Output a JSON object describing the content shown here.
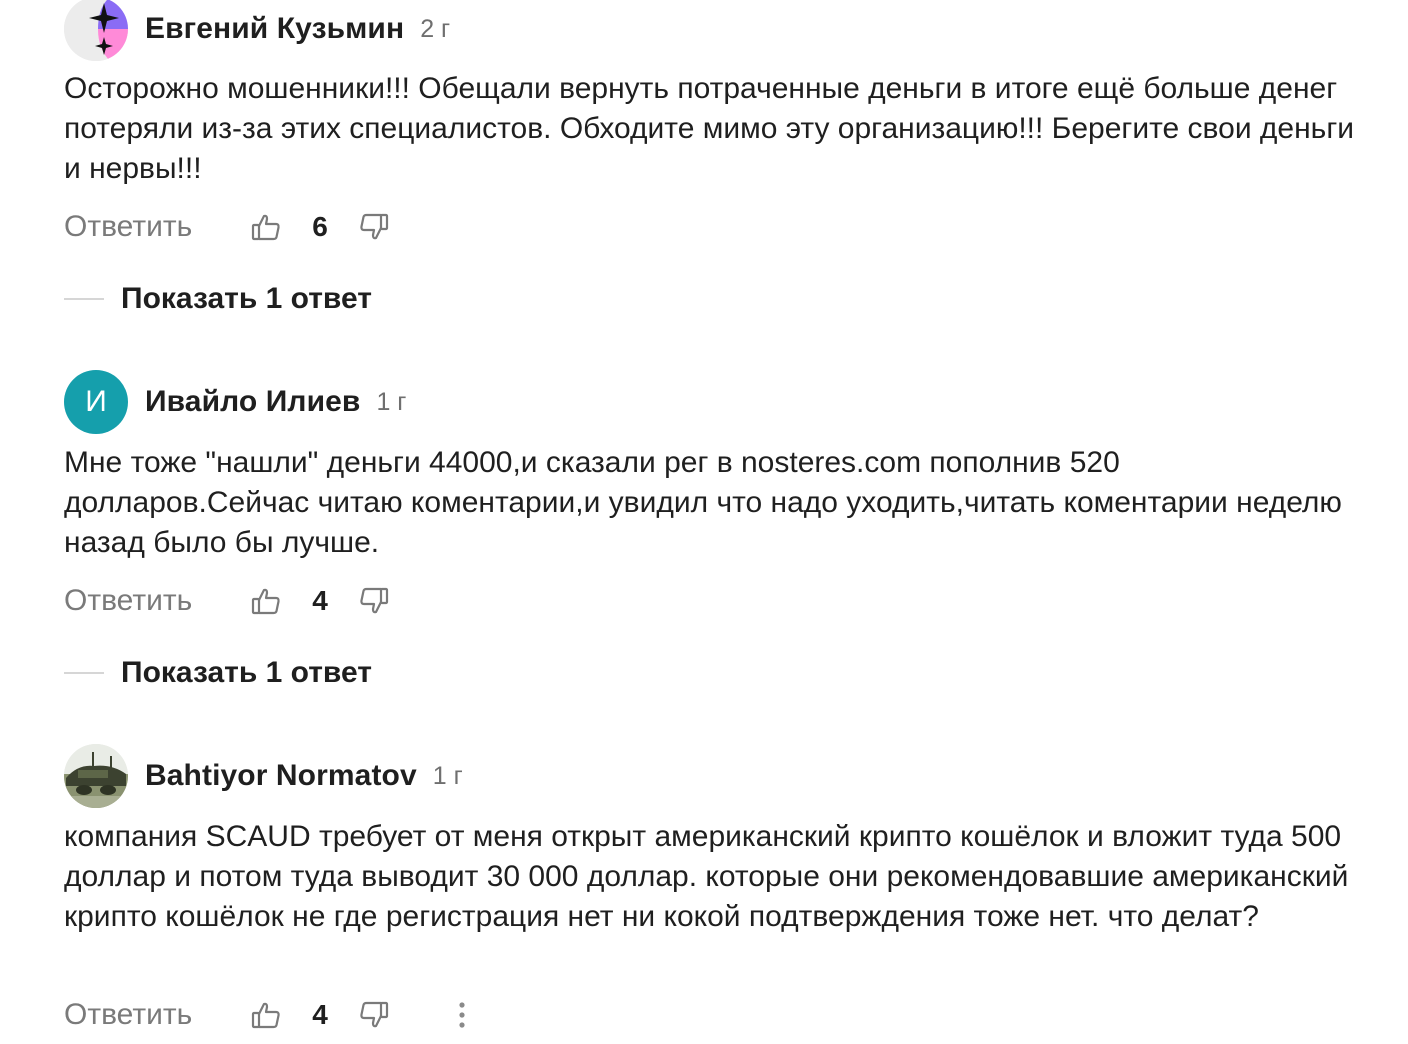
{
  "comments": [
    {
      "author": "Евгений Кузьмин",
      "age": "2 г",
      "avatar": {
        "type": "sparkle",
        "colors": [
          "#ececec",
          "#8a6cf5",
          "#ff8ad8",
          "#111111"
        ]
      },
      "text": "Осторожно мошенники!!! Обещали вернуть потраченные деньги в итоге ещё больше денег потеряли из-за этих специалистов. Обходите мимо эту организацию!!! Берегите свои деньги и нервы!!!",
      "reply_label": "Ответить",
      "likes": "6",
      "show_replies_label": "Показать 1 ответ"
    },
    {
      "author": "Ивайло Илиев",
      "age": "1 г",
      "avatar": {
        "type": "letter",
        "letter": "И",
        "color": "#159fac"
      },
      "text": "Мне тоже \"нашли\" деньги 44000,и сказали рег в nosteres.com пополнив 520 долларов.Сейчас читаю коментарии,и увидил что надо уходить,читать коментарии неделю назад было бы лучше.",
      "reply_label": "Ответить",
      "likes": "4",
      "show_replies_label": "Показать 1 ответ"
    },
    {
      "author": "Bahtiyor Normatov",
      "age": "1 г",
      "avatar": {
        "type": "photo",
        "colors": [
          "#e9ece6",
          "#6f7a5c",
          "#3c4230"
        ]
      },
      "text": "компания SCAUD требует от меня открыт американский крипто кошёлок и вложит туда 500 доллар и потом туда выводит 30 000 доллар. которые они рекомендовавшие американский крипто кошёлок не где регистрация нет ни кокой подтверждения тоже нет. что делат?",
      "reply_label": "Ответить",
      "likes": "4"
    }
  ],
  "icons": {
    "like": "thumbs-up-icon",
    "dislike": "thumbs-down-icon",
    "more": "more-vertical-icon"
  }
}
